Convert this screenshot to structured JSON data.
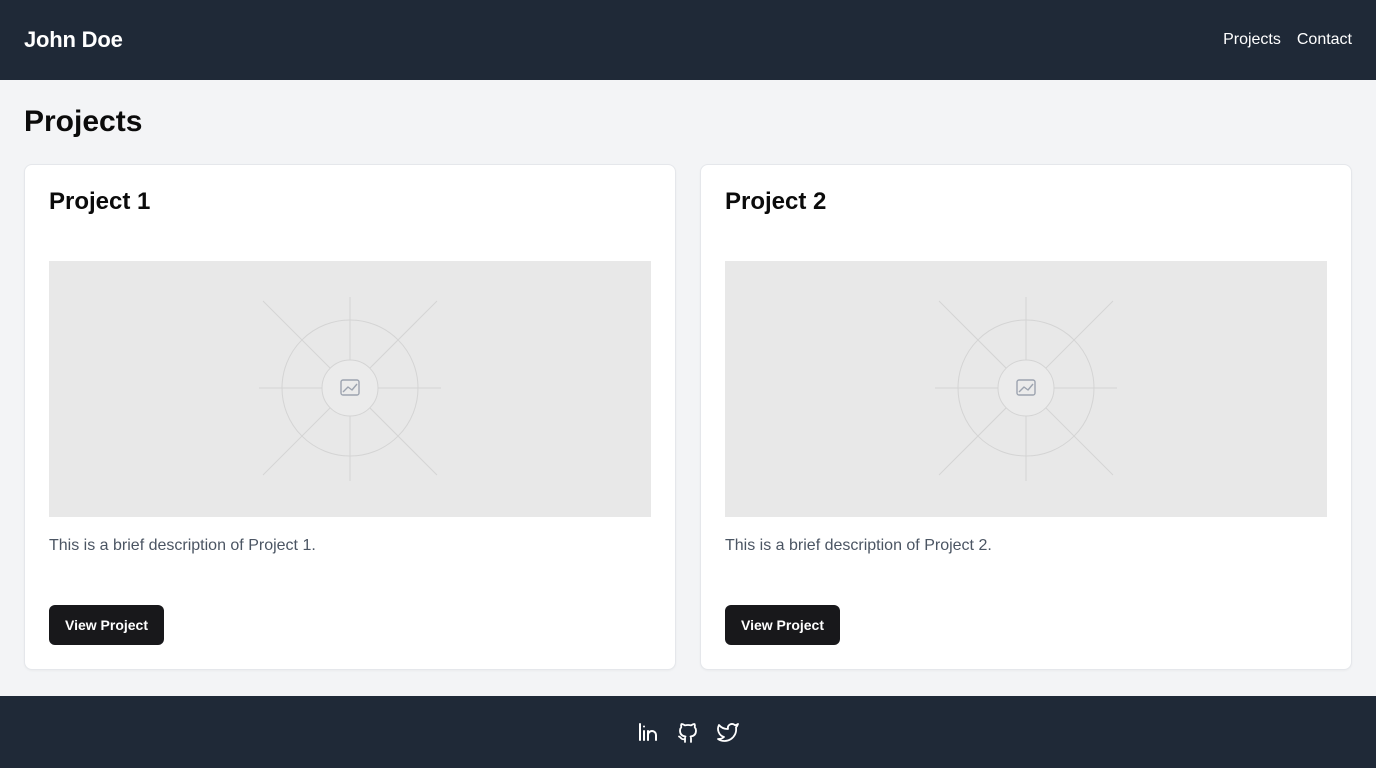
{
  "header": {
    "brand": "John Doe",
    "nav": [
      {
        "label": "Projects"
      },
      {
        "label": "Contact"
      }
    ]
  },
  "main": {
    "title": "Projects",
    "projects": [
      {
        "title": "Project 1",
        "image_icon": "image-placeholder-icon",
        "description": "This is a brief description of Project 1.",
        "button_label": "View Project"
      },
      {
        "title": "Project 2",
        "image_icon": "image-placeholder-icon",
        "description": "This is a brief description of Project 2.",
        "button_label": "View Project"
      }
    ]
  },
  "footer": {
    "social": [
      {
        "icon": "linkedin-icon"
      },
      {
        "icon": "github-icon"
      },
      {
        "icon": "twitter-icon"
      }
    ]
  },
  "colors": {
    "header_bg": "#1f2937",
    "page_bg": "#f3f4f6",
    "card_bg": "#ffffff",
    "button_bg": "#18181b",
    "placeholder_bg": "#e8e8e8",
    "description_text": "#4b5563"
  }
}
